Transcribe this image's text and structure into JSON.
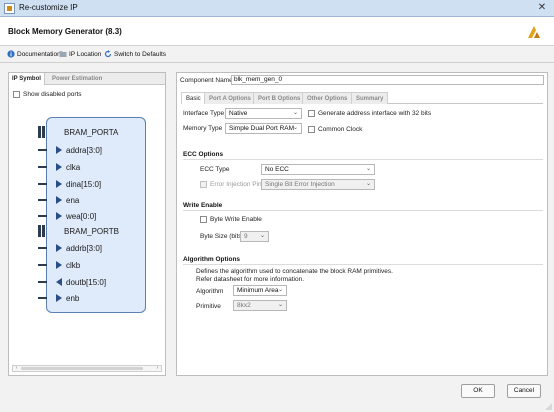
{
  "window": {
    "title": "Re-customize IP"
  },
  "header": {
    "title": "Block Memory Generator (8.3)"
  },
  "toolbar": {
    "documentation": "Documentation",
    "ip_location": "IP Location",
    "switch_defaults": "Switch to Defaults"
  },
  "left_panel": {
    "tabs": [
      "IP Symbol",
      "Power Estimation"
    ],
    "show_disabled_ports": "Show disabled ports",
    "ports": [
      {
        "label": "BRAM_PORTA",
        "kind": "bus"
      },
      {
        "label": "addra[3:0]",
        "kind": "in"
      },
      {
        "label": "clka",
        "kind": "in"
      },
      {
        "label": "dina[15:0]",
        "kind": "in"
      },
      {
        "label": "ena",
        "kind": "in"
      },
      {
        "label": "wea[0:0]",
        "kind": "in"
      },
      {
        "label": "BRAM_PORTB",
        "kind": "bus"
      },
      {
        "label": "addrb[3:0]",
        "kind": "in"
      },
      {
        "label": "clkb",
        "kind": "in"
      },
      {
        "label": "doutb[15:0]",
        "kind": "out"
      },
      {
        "label": "enb",
        "kind": "in"
      }
    ]
  },
  "right_panel": {
    "component_name_label": "Component Name",
    "component_name_value": "blk_mem_gen_0",
    "tabs": [
      "Basic",
      "Port A Options",
      "Port B Options",
      "Other Options",
      "Summary"
    ],
    "interface_type_label": "Interface Type",
    "interface_type_value": "Native",
    "memory_type_label": "Memory Type",
    "memory_type_value": "Simple Dual Port RAM",
    "gen_address_label": "Generate address interface with 32 bits",
    "common_clock_label": "Common Clock",
    "ecc_section": "ECC Options",
    "ecc_type_label": "ECC Type",
    "ecc_type_value": "No ECC",
    "error_injection_label": "Error Injection Pins",
    "error_injection_value": "Single Bit Error Injection",
    "write_enable_section": "Write Enable",
    "byte_write_enable_label": "Byte Write Enable",
    "byte_size_label": "Byte Size (bits)",
    "byte_size_value": "9",
    "algorithm_section": "Algorithm Options",
    "algorithm_desc1": "Defines the algorithm used to concatenate the block RAM primitives.",
    "algorithm_desc2": "Refer datasheet for more information.",
    "algorithm_label": "Algorithm",
    "algorithm_value": "Minimum Area",
    "primitive_label": "Primitive",
    "primitive_value": "8kx2"
  },
  "footer": {
    "ok": "OK",
    "cancel": "Cancel"
  },
  "colors": {
    "accent": "#3b78c2",
    "symbol_fill": "#dfeafa",
    "symbol_border": "#5a7fb0"
  }
}
